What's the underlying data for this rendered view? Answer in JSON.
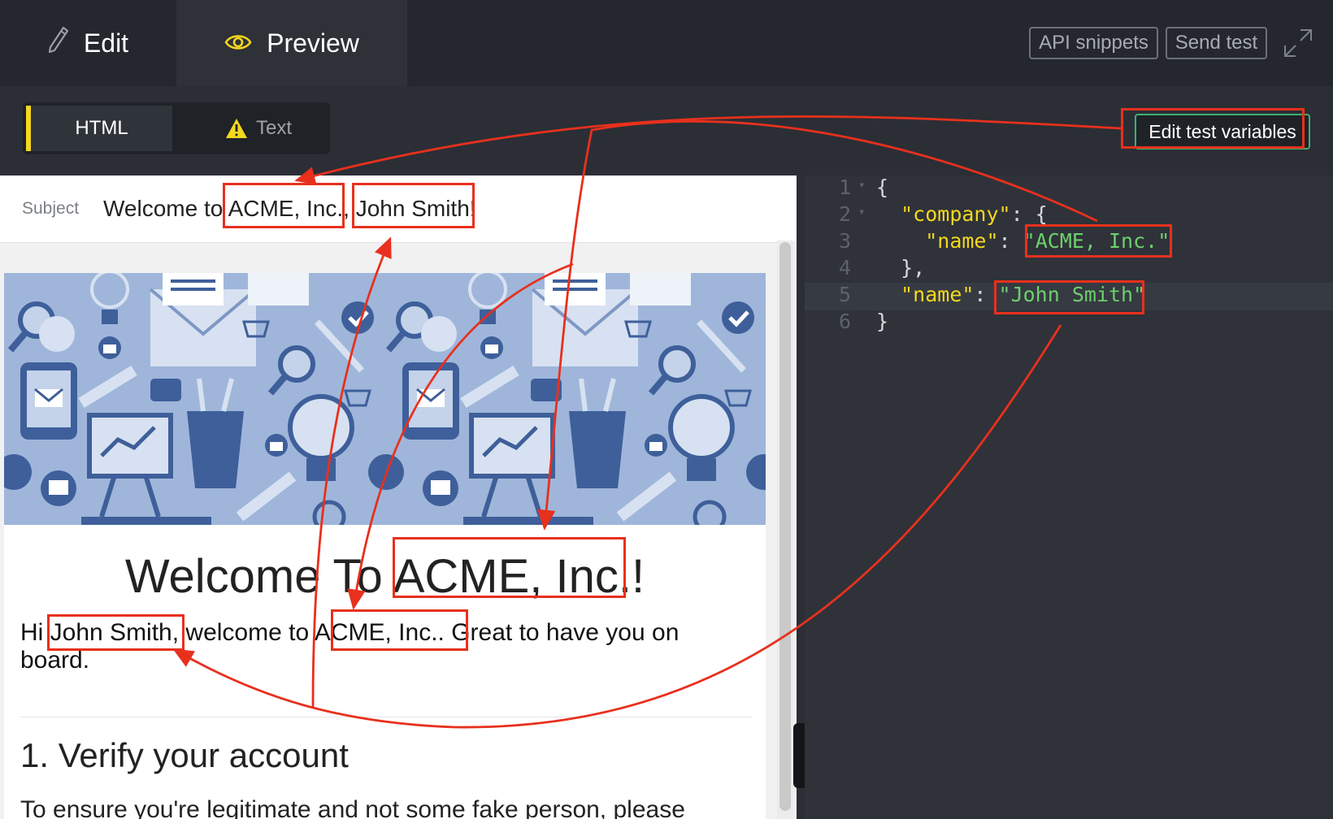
{
  "topbar": {
    "tabs": [
      {
        "label": "Edit",
        "icon": "pencil-icon"
      },
      {
        "label": "Preview",
        "icon": "eye-icon",
        "active": true
      }
    ],
    "api_snippets_label": "API snippets",
    "send_test_label": "Send test",
    "expand_icon": "expand-icon"
  },
  "subbar": {
    "mode_html_label": "HTML",
    "mode_text_label": "Text",
    "mode_text_icon": "warning-icon",
    "edit_vars_label": "Edit test variables"
  },
  "preview": {
    "subject_label": "Subject",
    "subject_prefix": "Welcome to ",
    "subject_company": "ACME, Inc.",
    "subject_sep": ", ",
    "subject_name": "John Smith",
    "subject_suffix": "!",
    "title_prefix": "Welcome To ",
    "title_company": "ACME, Inc.",
    "title_suffix": "!",
    "greeting_hi": "Hi ",
    "greeting_name": "John Smith",
    "greeting_mid": ", welcome to ",
    "greeting_company": "ACME, Inc.",
    "greeting_end": ". Great to have you on board.",
    "step_title": "1. Verify your account",
    "step_desc": "To ensure you're legitimate and not some fake person, please"
  },
  "code": {
    "lines": [
      {
        "n": "1",
        "fold": true
      },
      {
        "n": "2",
        "fold": true
      },
      {
        "n": "3",
        "fold": false
      },
      {
        "n": "4",
        "fold": false
      },
      {
        "n": "5",
        "fold": false,
        "active": true
      },
      {
        "n": "6",
        "fold": false
      }
    ],
    "brace_open": "{",
    "company_key": "\"company\"",
    "company_open": ": {",
    "name_key": "\"name\"",
    "colon": ": ",
    "company_name_value": "\"ACME, Inc.\"",
    "inner_close": "},",
    "person_name_value": "\"John Smith\"",
    "brace_close": "}"
  },
  "colors": {
    "accent_yellow": "#f4d71e",
    "json_string_green": "#6cd06b",
    "annotation_red": "#e8301d",
    "button_green_border": "#39b36f"
  }
}
